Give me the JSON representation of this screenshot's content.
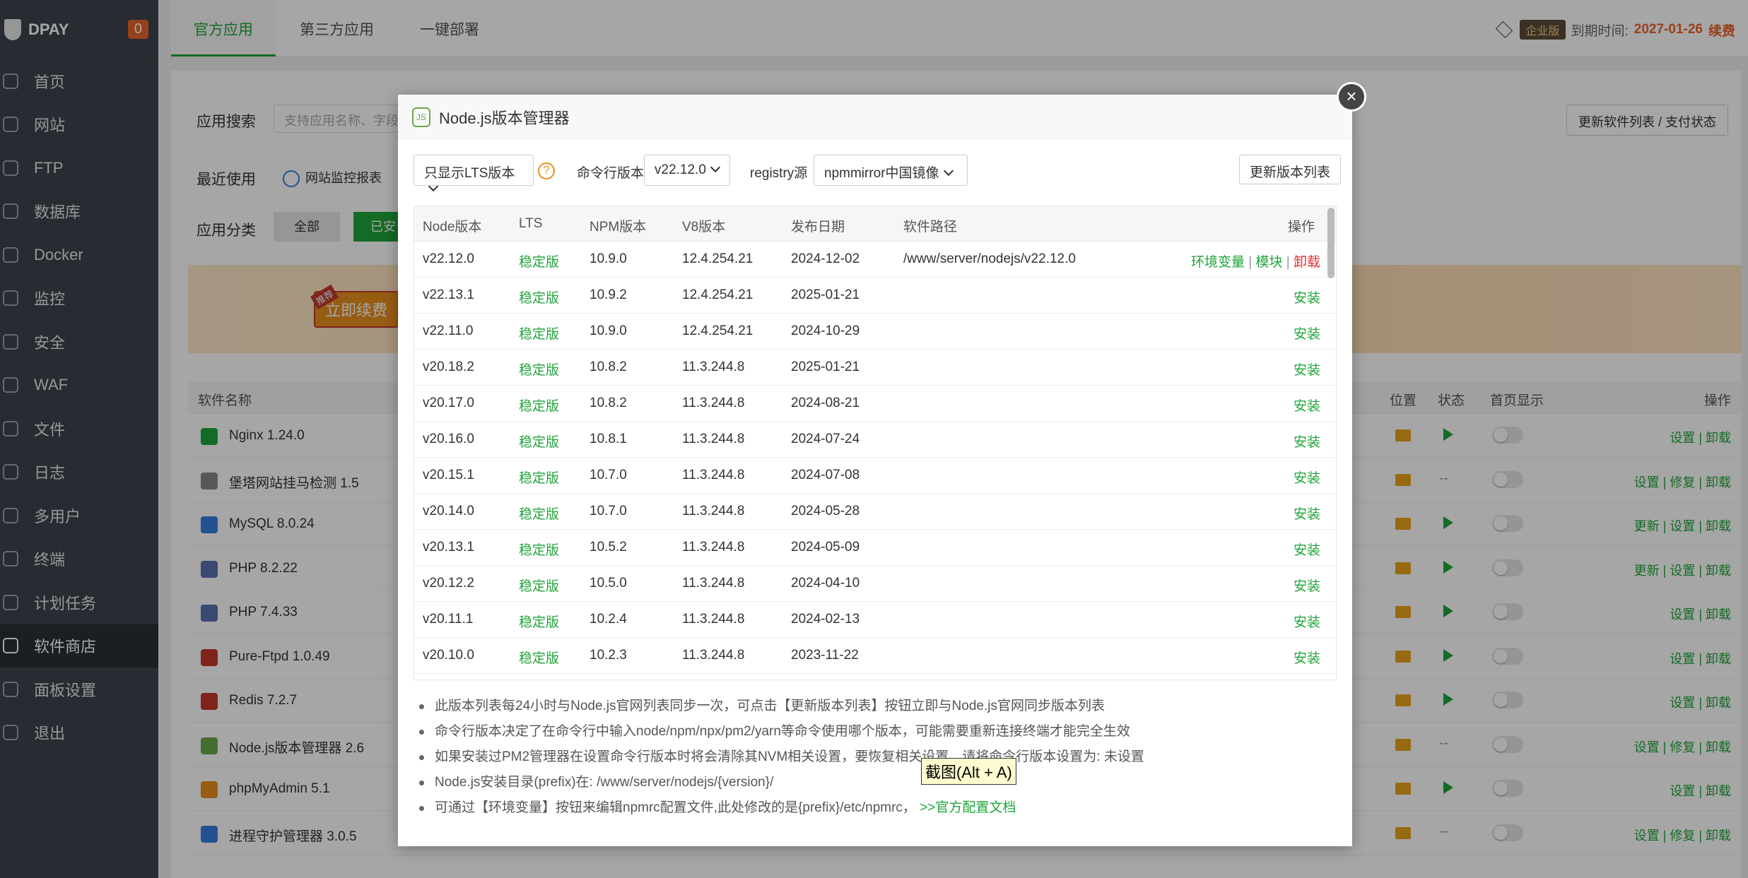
{
  "sidebar": {
    "brand": "DPAY",
    "badge": "0",
    "items": [
      {
        "label": "首页",
        "icon": "home-icon"
      },
      {
        "label": "网站",
        "icon": "globe-icon"
      },
      {
        "label": "FTP",
        "icon": "ftp-icon"
      },
      {
        "label": "数据库",
        "icon": "database-icon"
      },
      {
        "label": "Docker",
        "icon": "docker-icon"
      },
      {
        "label": "监控",
        "icon": "monitor-icon"
      },
      {
        "label": "安全",
        "icon": "shield-icon"
      },
      {
        "label": "WAF",
        "icon": "waf-icon"
      },
      {
        "label": "文件",
        "icon": "folder-icon"
      },
      {
        "label": "日志",
        "icon": "log-icon"
      },
      {
        "label": "多用户",
        "icon": "users-icon"
      },
      {
        "label": "终端",
        "icon": "terminal-icon"
      },
      {
        "label": "计划任务",
        "icon": "calendar-icon"
      },
      {
        "label": "软件商店",
        "icon": "grid-icon",
        "active": true
      },
      {
        "label": "面板设置",
        "icon": "gear-icon"
      },
      {
        "label": "退出",
        "icon": "logout-icon"
      }
    ]
  },
  "header": {
    "tabs": [
      "官方应用",
      "第三方应用",
      "一键部署"
    ],
    "edition": "企业版",
    "expire_label": "到期时间:",
    "expire_date": "2027-01-26",
    "renew": "续费"
  },
  "store": {
    "search_label": "应用搜索",
    "search_placeholder": "支持应用名称、字段",
    "update_button": "更新软件列表 / 支付状态",
    "recent_label": "最近使用",
    "recent_item": "网站监控报表",
    "category_label": "应用分类",
    "category_all": "全部",
    "category_installed": "已安",
    "banner_button": "立即续费",
    "banner_tag": "推荐",
    "columns": {
      "name": "软件名称",
      "location": "位置",
      "status": "状态",
      "home": "首页显示",
      "ops": "操作"
    },
    "apps": [
      {
        "name": "Nginx 1.24.0",
        "running": true,
        "ops": "设置 | 卸载"
      },
      {
        "name": "堡塔网站挂马检测 1.5",
        "running": false,
        "ops": "设置 | 修复 | 卸载"
      },
      {
        "name": "MySQL 8.0.24",
        "running": true,
        "ops": "更新 | 设置 | 卸载"
      },
      {
        "name": "PHP 8.2.22",
        "running": true,
        "ops": "更新 | 设置 | 卸载"
      },
      {
        "name": "PHP 7.4.33",
        "running": true,
        "ops": "设置 | 卸载"
      },
      {
        "name": "Pure-Ftpd 1.0.49",
        "running": true,
        "ops": "设置 | 卸载"
      },
      {
        "name": "Redis 7.2.7",
        "running": true,
        "ops": "设置 | 卸载"
      },
      {
        "name": "Node.js版本管理器 2.6",
        "running": false,
        "ops": "设置 | 修复 | 卸载"
      },
      {
        "name": "phpMyAdmin 5.1",
        "running": true,
        "ops": "设置 | 卸载"
      },
      {
        "name": "进程守护管理器 3.0.5",
        "running": false,
        "ops": "设置 | 修复 | 卸载"
      }
    ],
    "dash": "--"
  },
  "modal": {
    "title": "Node.js版本管理器",
    "close": "×",
    "filter": "只显示LTS版本",
    "help": "?",
    "cli_label": "命令行版本",
    "cli_value": "v22.12.0",
    "registry_label": "registry源",
    "registry_value": "npmmirror中国镜像",
    "update_list": "更新版本列表",
    "columns": [
      "Node版本",
      "LTS",
      "NPM版本",
      "V8版本",
      "发布日期",
      "软件路径",
      "操作"
    ],
    "rows": [
      {
        "node": "v22.12.0",
        "lts": "稳定版",
        "npm": "10.9.0",
        "v8": "12.4.254.21",
        "date": "2024-12-02",
        "path": "/www/server/nodejs/v22.12.0",
        "installed": true
      },
      {
        "node": "v22.13.1",
        "lts": "稳定版",
        "npm": "10.9.2",
        "v8": "12.4.254.21",
        "date": "2025-01-21",
        "path": "",
        "installed": false
      },
      {
        "node": "v22.11.0",
        "lts": "稳定版",
        "npm": "10.9.0",
        "v8": "12.4.254.21",
        "date": "2024-10-29",
        "path": "",
        "installed": false
      },
      {
        "node": "v20.18.2",
        "lts": "稳定版",
        "npm": "10.8.2",
        "v8": "11.3.244.8",
        "date": "2025-01-21",
        "path": "",
        "installed": false
      },
      {
        "node": "v20.17.0",
        "lts": "稳定版",
        "npm": "10.8.2",
        "v8": "11.3.244.8",
        "date": "2024-08-21",
        "path": "",
        "installed": false
      },
      {
        "node": "v20.16.0",
        "lts": "稳定版",
        "npm": "10.8.1",
        "v8": "11.3.244.8",
        "date": "2024-07-24",
        "path": "",
        "installed": false
      },
      {
        "node": "v20.15.1",
        "lts": "稳定版",
        "npm": "10.7.0",
        "v8": "11.3.244.8",
        "date": "2024-07-08",
        "path": "",
        "installed": false
      },
      {
        "node": "v20.14.0",
        "lts": "稳定版",
        "npm": "10.7.0",
        "v8": "11.3.244.8",
        "date": "2024-05-28",
        "path": "",
        "installed": false
      },
      {
        "node": "v20.13.1",
        "lts": "稳定版",
        "npm": "10.5.2",
        "v8": "11.3.244.8",
        "date": "2024-05-09",
        "path": "",
        "installed": false
      },
      {
        "node": "v20.12.2",
        "lts": "稳定版",
        "npm": "10.5.0",
        "v8": "11.3.244.8",
        "date": "2024-04-10",
        "path": "",
        "installed": false
      },
      {
        "node": "v20.11.1",
        "lts": "稳定版",
        "npm": "10.2.4",
        "v8": "11.3.244.8",
        "date": "2024-02-13",
        "path": "",
        "installed": false
      },
      {
        "node": "v20.10.0",
        "lts": "稳定版",
        "npm": "10.2.3",
        "v8": "11.3.244.8",
        "date": "2023-11-22",
        "path": "",
        "installed": false
      }
    ],
    "op_env": "环境变量",
    "op_module": "模块",
    "op_uninstall": "卸载",
    "op_install": "安装",
    "op_sep": "|",
    "notes": [
      "此版本列表每24小时与Node.js官网列表同步一次，可点击【更新版本列表】按钮立即与Node.js官网同步版本列表",
      "命令行版本决定了在命令行中输入node/npm/npx/pm2/yarn等命令使用哪个版本，可能需要重新连接终端才能完全生效",
      "如果安装过PM2管理器在设置命令行版本时将会清除其NVM相关设置，要恢复相关设置，请将命令行版本设置为: 未设置",
      "Node.js安装目录(prefix)在: /www/server/nodejs/{version}/",
      "可通过【环境变量】按钮来编辑npmrc配置文件,此处修改的是{prefix}/etc/npmrc，"
    ],
    "doc_link": ">>官方配置文档"
  },
  "tooltip": "截图(Alt + A)"
}
